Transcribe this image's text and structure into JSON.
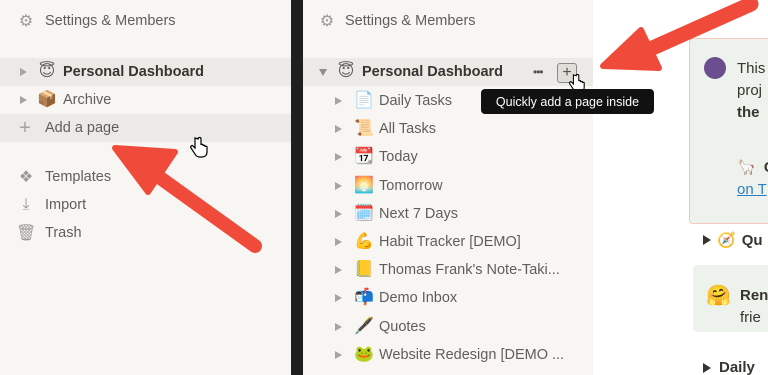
{
  "left_sidebar": {
    "settings_label": "Settings & Members",
    "items": [
      {
        "emoji": "😇",
        "label": "Personal Dashboard"
      },
      {
        "emoji": "📦",
        "label": "Archive"
      }
    ],
    "add_page_label": "Add a page",
    "templates_label": "Templates",
    "import_label": "Import",
    "trash_label": "Trash"
  },
  "middle_sidebar": {
    "settings_label": "Settings & Members",
    "parent": {
      "emoji": "😇",
      "label": "Personal Dashboard"
    },
    "children": [
      {
        "emoji": "📄",
        "label": "Daily Tasks"
      },
      {
        "emoji": "📜",
        "label": "All Tasks"
      },
      {
        "emoji": "📆",
        "label": "Today"
      },
      {
        "emoji": "🌅",
        "label": "Tomorrow"
      },
      {
        "emoji": "🗓️",
        "label": "Next 7 Days"
      },
      {
        "emoji": "💪",
        "label": "Habit Tracker [DEMO]"
      },
      {
        "emoji": "📒",
        "label": "Thomas Frank's Note-Taki..."
      },
      {
        "emoji": "📬",
        "label": "Demo Inbox"
      },
      {
        "emoji": "🖋️",
        "label": "Quotes"
      },
      {
        "emoji": "🐸",
        "label": "Website Redesign [DEMO ..."
      }
    ],
    "more_glyph": "•••",
    "add_glyph": "+",
    "tooltip": "Quickly add a page inside"
  },
  "right_content": {
    "callout1_line1": "This",
    "callout1_line2": "proj",
    "callout1_line3": "the",
    "callout1_emoji": "🦙",
    "callout1_bold": "C",
    "callout1_link": "on T",
    "toggle1_emoji": "🧭",
    "toggle1_label": "Qu",
    "callout2_emoji": "🤗",
    "callout2_line1": "Ren",
    "callout2_line2": "frie",
    "toggle2_label": "Daily"
  },
  "colors": {
    "sidebar_bg": "#f7f6f3",
    "divider": "#1f1f1f",
    "arrow": "#f04b3a",
    "tooltip_bg": "#111111",
    "link": "#2e7fbf",
    "callout_border": "#f3c7bf",
    "callout_bg": "#edf3ec"
  }
}
